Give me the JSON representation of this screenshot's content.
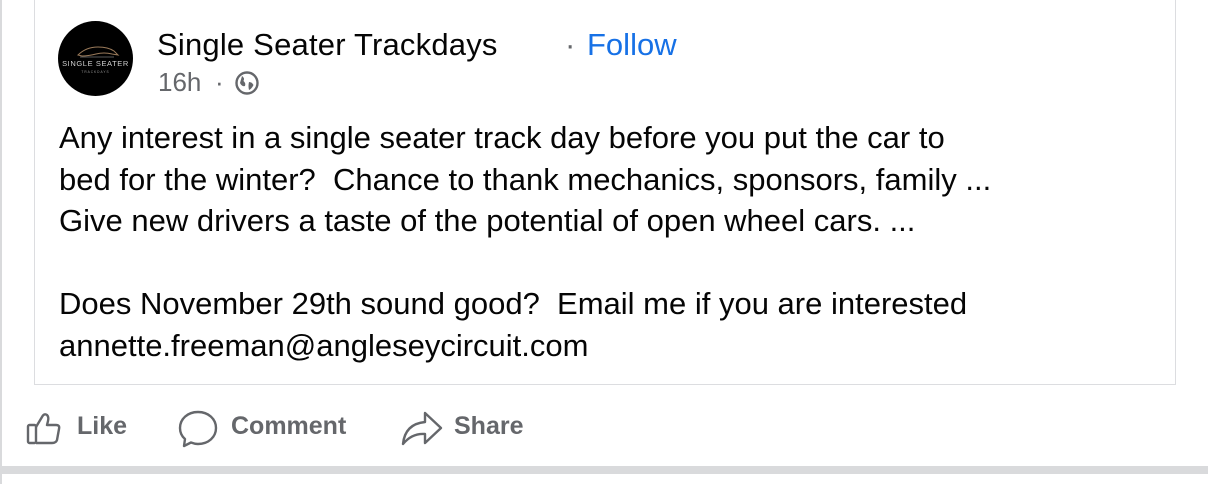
{
  "post": {
    "author": "Single Seater Trackdays",
    "separator": "·",
    "follow_label": "Follow",
    "time": "16h",
    "meta_separator": "·",
    "audience_icon": "globe-icon",
    "avatar_text": "SINGLE SEATER",
    "avatar_subtext": "TRACKDAYS",
    "body_lines": [
      "Any interest in a single seater track day before you put the car to",
      "bed for the winter?  Chance to thank mechanics, sponsors, family ...",
      "Give new drivers a taste of the potential of open wheel cars. ...",
      "",
      "Does November 29th sound good?  Email me if you are interested",
      "annette.freeman@angleseycircuit.com"
    ]
  },
  "actions": {
    "like_label": "Like",
    "comment_label": "Comment",
    "share_label": "Share",
    "like_icon": "thumbs-up-icon",
    "comment_icon": "comment-bubble-icon",
    "share_icon": "share-arrow-icon"
  },
  "colors": {
    "text": "#050505",
    "secondary": "#65676b",
    "follow": "#1771e6",
    "divider": "#d9dadc"
  }
}
